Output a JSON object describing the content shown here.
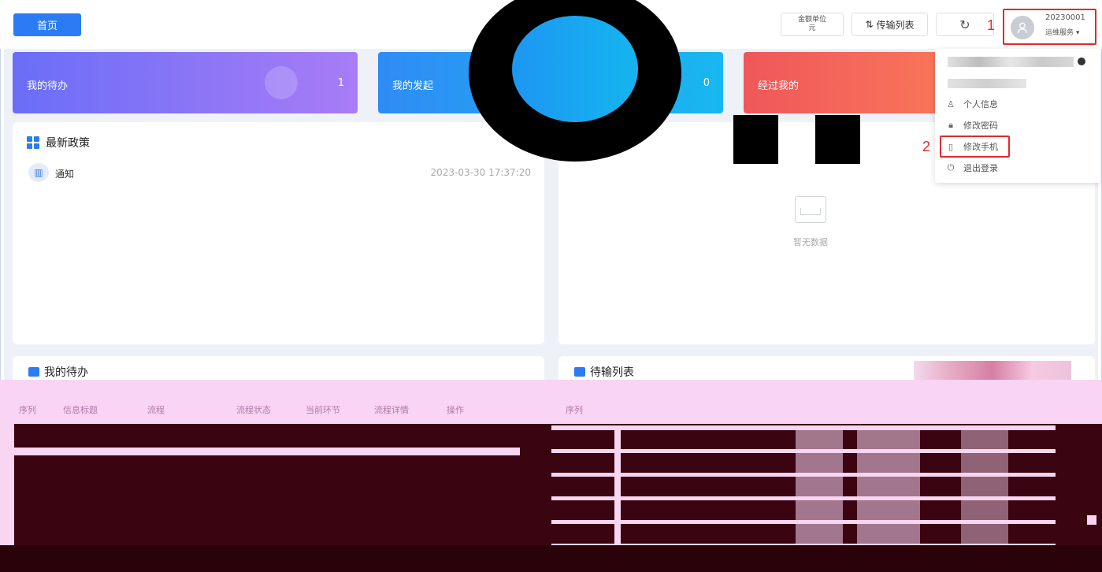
{
  "topbar": {
    "home_label": "首页",
    "unit_line1": "金额单位",
    "unit_line2": "元",
    "transfer_label": "传输列表",
    "refresh_icon": "refresh-icon",
    "user_id": "20230001",
    "user_role": "运维服务 ▾",
    "annotation_1": "1",
    "annotation_2": "2"
  },
  "cards": [
    {
      "label": "我的待办",
      "count": "1"
    },
    {
      "label": "我的发起",
      "count": "0"
    },
    {
      "label": "经过我的",
      "count": ""
    }
  ],
  "policy": {
    "title": "最新政策",
    "items": [
      {
        "title": "通知",
        "date": "2023-03-30 17:37:20"
      }
    ]
  },
  "right_panel": {
    "empty_text": "暂无数据"
  },
  "user_menu": {
    "items": [
      {
        "icon": "person-icon",
        "label": "个人信息"
      },
      {
        "icon": "lock-icon",
        "label": "修改密码"
      },
      {
        "icon": "phone-icon",
        "label": "修改手机"
      },
      {
        "icon": "power-icon",
        "label": "退出登录"
      }
    ]
  },
  "bottom_left": {
    "title": "我的待办",
    "columns": [
      "序列",
      "信息标题",
      "流程",
      "流程状态",
      "当前环节",
      "流程详情",
      "操作"
    ]
  },
  "bottom_right": {
    "title": "待输列表",
    "columns": [
      "序列"
    ]
  }
}
